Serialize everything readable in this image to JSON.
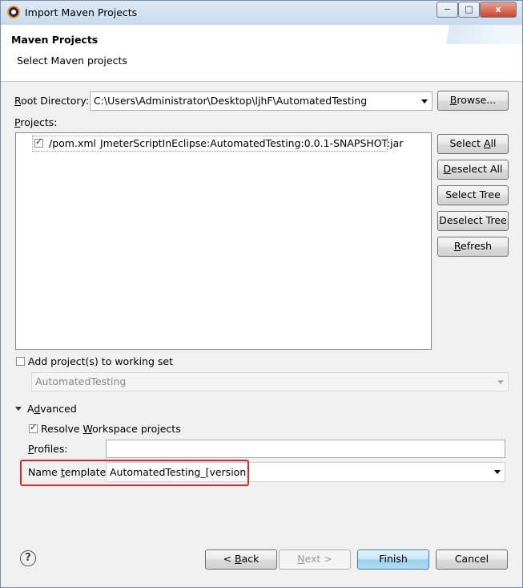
{
  "window": {
    "title": "Import Maven Projects",
    "controls": {
      "minimize": "−",
      "maximize": "□",
      "close": "x"
    }
  },
  "banner": {
    "title": "Maven Projects",
    "subtitle": "Select Maven projects"
  },
  "root_directory": {
    "label_first": "R",
    "label_rest": "oot Directory:",
    "value": "C:\\Users\\Administrator\\Desktop\\ljhF\\AutomatedTesting",
    "browse_underline": "B",
    "browse_rest": "rowse..."
  },
  "projects": {
    "label_first": "P",
    "label_rest": "rojects:",
    "items": [
      {
        "checked": true,
        "path": "/pom.xml",
        "artifact": "JmeterScriptInEclipse:AutomatedTesting:0.0.1-SNAPSHOT:jar"
      }
    ]
  },
  "side_buttons": {
    "select_all_pre": "Select ",
    "select_all_u": "A",
    "select_all_post": "ll",
    "deselect_all_pre": "",
    "deselect_all_u": "D",
    "deselect_all_post": "eselect All",
    "select_tree": "Select Tree",
    "deselect_tree": "Deselect Tree",
    "refresh_u": "R",
    "refresh_post": "efresh"
  },
  "working_set": {
    "checked": false,
    "label": "Add project(s) to working set",
    "value": "AutomatedTesting"
  },
  "advanced": {
    "label_pre": "A",
    "label_u": "d",
    "label_post": "vanced",
    "resolve_checked": true,
    "resolve_pre": "Resolve ",
    "resolve_u": "W",
    "resolve_post": "orkspace projects",
    "profiles_label_u": "P",
    "profiles_label_post": "rofiles:",
    "profiles_value": "",
    "name_template_pre": "Name ",
    "name_template_u": "t",
    "name_template_post": "emplate:",
    "name_template_value": "AutomatedTesting_[version]"
  },
  "footer": {
    "help_icon": "?",
    "back_pre": "< ",
    "back_u": "B",
    "back_post": "ack",
    "next_u": "N",
    "next_post": "ext >",
    "finish": "Finish",
    "cancel": "Cancel"
  },
  "colors": {
    "highlight_box": "#e0252b",
    "default_button": "#98d1ef"
  }
}
